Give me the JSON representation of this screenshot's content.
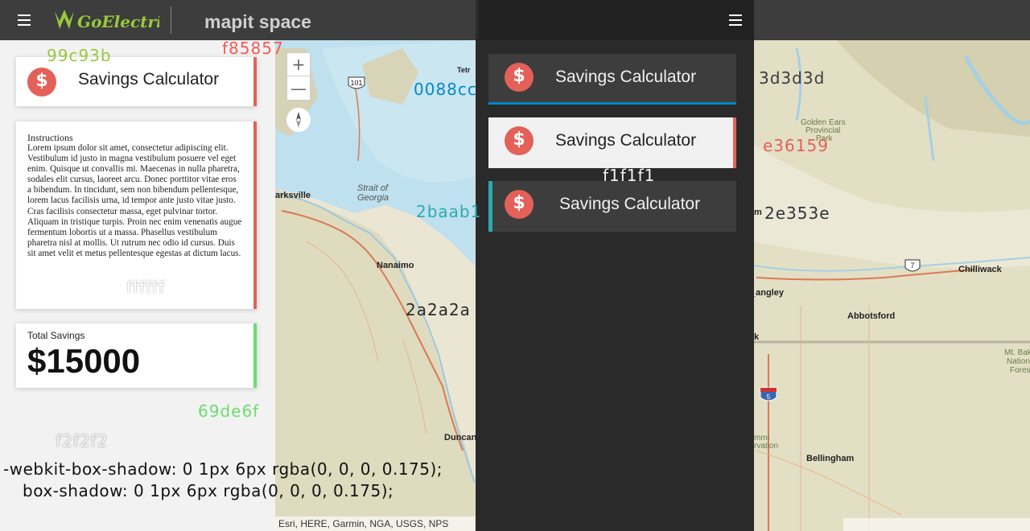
{
  "app": {
    "brand_logo": "GoElectric",
    "partner_logo": "mapit space"
  },
  "left_panel": {
    "title_card": {
      "icon": "dollar-icon",
      "title": "Savings Calculator"
    },
    "instructions": {
      "heading": "Instructions",
      "body": "Lorem ipsum dolor sit amet, consectetur adipiscing elit. Vestibulum id justo in magna vestibulum posuere vel eget enim. Quisque ut convallis mi. Maecenas in nulla pharetra, sodales elit cursus, laoreet arcu. Donec porttitor vitae eros a bibendum. In tincidunt, sem non bibendum pellentesque, lorem lacus facilisis urna, id tempor ante justo vitae justo. Cras facilisis consectetur massa, eget pulvinar tortor. Aliquam in tristique turpis. Proin nec enim venenatis augue fermentum lobortis ut a massa. Phasellus vestibulum pharetra nisl at mollis. Ut rutrum nec odio id cursus. Duis sit amet velit et metus pellentesque egestas at dictum lacus."
    },
    "savings": {
      "label": "Total Savings",
      "value": "$15000"
    }
  },
  "map": {
    "zoom_in": "+",
    "zoom_out": "—",
    "compass_icon": "compass-icon",
    "attribution": "Esri, HERE, Garmin, NGA, USGS, NPS",
    "labels": {
      "strait1": "Strait of",
      "strait2": "Georgia",
      "parksville": "arksville",
      "nanaimo": "Nanaimo",
      "duncan": "Duncan",
      "chilliwack": "Chilliwack",
      "abbotsford": "Abbotsford",
      "langley": "_angley",
      "bellingham": "Bellingham",
      "golden1": "Golden Ears",
      "golden2": "Provincial",
      "golden3": "Park",
      "mtbaker1": "Mt. Bak",
      "mtbaker2": "Nation",
      "mtbaker3": "Fores",
      "hwy101": "101",
      "hwy7": "7",
      "hwy5": "5",
      "m": "m",
      "k": "k",
      "tetr1": "Tetr",
      "tetr2": "P",
      "ammi1": "mmi",
      "ammi2": "rvation"
    }
  },
  "dark_panel": {
    "cards": [
      {
        "label": "Savings Calculator",
        "icon": "dollar-icon"
      },
      {
        "label": "Savings Calculator",
        "icon": "dollar-icon"
      },
      {
        "label": "Savings Calculator",
        "icon": "dollar-icon"
      }
    ]
  },
  "color_annotations": {
    "green": "99c93b",
    "red_top": "f85857",
    "blue": "0088cc",
    "dark_grey": "3d3d3d",
    "red": "e36159",
    "light": "f1f1f1",
    "teal": "2baab1",
    "navy": "2e353e",
    "white": "ffffff",
    "panel_dark": "2a2a2a",
    "green_bright": "69de6f",
    "bg": "f2f2f2"
  },
  "css_note": {
    "line1": "-webkit-box-shadow: 0 1px 6px rgba(0, 0, 0, 0.175);",
    "line2": "box-shadow: 0 1px 6px rgba(0, 0, 0, 0.175);"
  },
  "colors": {
    "accent_red": "#e36159",
    "accent_blue": "#0088cc",
    "accent_teal": "#2baab1",
    "accent_green": "#69de6f",
    "logo_green": "#99c93b",
    "topbar": "#3d3d3d",
    "dark_panel": "#2a2a2a"
  }
}
